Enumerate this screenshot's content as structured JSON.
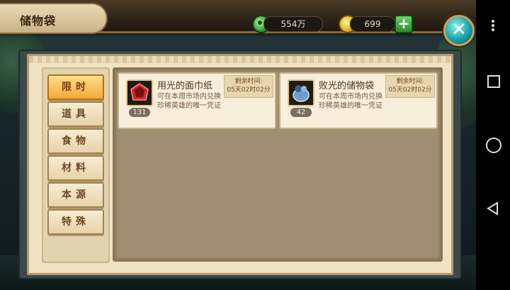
{
  "header": {
    "title": "储物袋",
    "jade_amount": "554万",
    "gold_amount": "699",
    "add_label": "+",
    "close_label": "✕"
  },
  "tabs": [
    {
      "label": "限时",
      "active": true
    },
    {
      "label": "道具",
      "active": false
    },
    {
      "label": "食物",
      "active": false
    },
    {
      "label": "材料",
      "active": false
    },
    {
      "label": "本源",
      "active": false
    },
    {
      "label": "特殊",
      "active": false
    }
  ],
  "items": [
    {
      "name": "用光的面巾纸",
      "description": "可在本周市场内兑换珍稀英雄的唯一凭证",
      "count": "131",
      "timer_label": "剩余时间:",
      "timer_value": "05天02时02分",
      "icon": "red-gem-icon"
    },
    {
      "name": "败光的储物袋",
      "description": "可在本周市场内兑换珍稀英雄的唯一凭证",
      "count": "42",
      "timer_label": "剩余时间:",
      "timer_value": "05天02时02分",
      "icon": "blue-bag-icon"
    }
  ],
  "android_nav": {
    "menu_icon": "more-vert-icon",
    "recents_icon": "square-icon",
    "home_icon": "circle-icon",
    "back_icon": "triangle-back-icon"
  }
}
